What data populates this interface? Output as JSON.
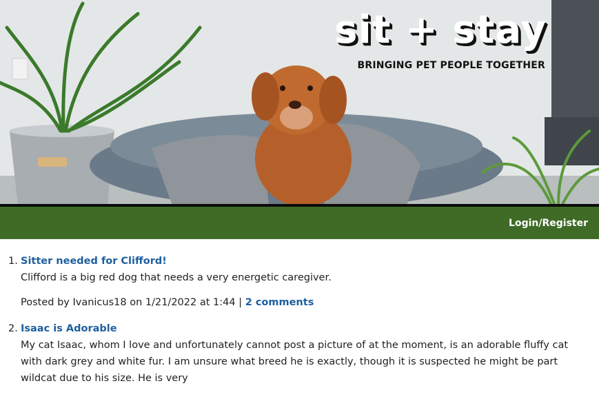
{
  "header": {
    "site_title": "sit + stay",
    "tagline": "BRINGING PET PEOPLE TOGETHER",
    "hero_image": "golden-dog-on-pet-bed-photo"
  },
  "nav": {
    "login_label": "Login/Register"
  },
  "colors": {
    "nav_bg": "#3f6b27",
    "link": "#1e5f9e"
  },
  "posts": [
    {
      "number": "1.",
      "title": "Sitter needed for Clifford!",
      "body": "Clifford is a big red dog that needs a very energetic caregiver.",
      "meta_prefix": "Posted by Ivanicus18 on 1/21/2022 at 1:44 |",
      "comments_label": "2 comments"
    },
    {
      "number": "2.",
      "title": "Isaac is Adorable",
      "body": "My cat Isaac, whom I love and unfortunately cannot post a picture of at the moment, is an adorable fluffy cat with dark grey and white fur. I am unsure what breed he is exactly, though it is suspected he might be part wildcat due to his size. He is very"
    }
  ]
}
